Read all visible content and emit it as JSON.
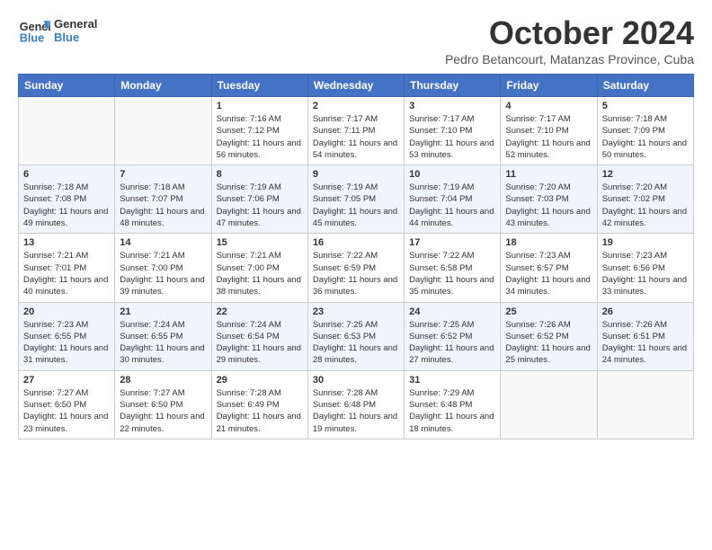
{
  "header": {
    "logo_line1": "General",
    "logo_line2": "Blue",
    "month": "October 2024",
    "location": "Pedro Betancourt, Matanzas Province, Cuba"
  },
  "days_of_week": [
    "Sunday",
    "Monday",
    "Tuesday",
    "Wednesday",
    "Thursday",
    "Friday",
    "Saturday"
  ],
  "weeks": [
    [
      {
        "day": "",
        "info": ""
      },
      {
        "day": "",
        "info": ""
      },
      {
        "day": "1",
        "info": "Sunrise: 7:16 AM\nSunset: 7:12 PM\nDaylight: 11 hours and 56 minutes."
      },
      {
        "day": "2",
        "info": "Sunrise: 7:17 AM\nSunset: 7:11 PM\nDaylight: 11 hours and 54 minutes."
      },
      {
        "day": "3",
        "info": "Sunrise: 7:17 AM\nSunset: 7:10 PM\nDaylight: 11 hours and 53 minutes."
      },
      {
        "day": "4",
        "info": "Sunrise: 7:17 AM\nSunset: 7:10 PM\nDaylight: 11 hours and 52 minutes."
      },
      {
        "day": "5",
        "info": "Sunrise: 7:18 AM\nSunset: 7:09 PM\nDaylight: 11 hours and 50 minutes."
      }
    ],
    [
      {
        "day": "6",
        "info": "Sunrise: 7:18 AM\nSunset: 7:08 PM\nDaylight: 11 hours and 49 minutes."
      },
      {
        "day": "7",
        "info": "Sunrise: 7:18 AM\nSunset: 7:07 PM\nDaylight: 11 hours and 48 minutes."
      },
      {
        "day": "8",
        "info": "Sunrise: 7:19 AM\nSunset: 7:06 PM\nDaylight: 11 hours and 47 minutes."
      },
      {
        "day": "9",
        "info": "Sunrise: 7:19 AM\nSunset: 7:05 PM\nDaylight: 11 hours and 45 minutes."
      },
      {
        "day": "10",
        "info": "Sunrise: 7:19 AM\nSunset: 7:04 PM\nDaylight: 11 hours and 44 minutes."
      },
      {
        "day": "11",
        "info": "Sunrise: 7:20 AM\nSunset: 7:03 PM\nDaylight: 11 hours and 43 minutes."
      },
      {
        "day": "12",
        "info": "Sunrise: 7:20 AM\nSunset: 7:02 PM\nDaylight: 11 hours and 42 minutes."
      }
    ],
    [
      {
        "day": "13",
        "info": "Sunrise: 7:21 AM\nSunset: 7:01 PM\nDaylight: 11 hours and 40 minutes."
      },
      {
        "day": "14",
        "info": "Sunrise: 7:21 AM\nSunset: 7:00 PM\nDaylight: 11 hours and 39 minutes."
      },
      {
        "day": "15",
        "info": "Sunrise: 7:21 AM\nSunset: 7:00 PM\nDaylight: 11 hours and 38 minutes."
      },
      {
        "day": "16",
        "info": "Sunrise: 7:22 AM\nSunset: 6:59 PM\nDaylight: 11 hours and 36 minutes."
      },
      {
        "day": "17",
        "info": "Sunrise: 7:22 AM\nSunset: 6:58 PM\nDaylight: 11 hours and 35 minutes."
      },
      {
        "day": "18",
        "info": "Sunrise: 7:23 AM\nSunset: 6:57 PM\nDaylight: 11 hours and 34 minutes."
      },
      {
        "day": "19",
        "info": "Sunrise: 7:23 AM\nSunset: 6:56 PM\nDaylight: 11 hours and 33 minutes."
      }
    ],
    [
      {
        "day": "20",
        "info": "Sunrise: 7:23 AM\nSunset: 6:55 PM\nDaylight: 11 hours and 31 minutes."
      },
      {
        "day": "21",
        "info": "Sunrise: 7:24 AM\nSunset: 6:55 PM\nDaylight: 11 hours and 30 minutes."
      },
      {
        "day": "22",
        "info": "Sunrise: 7:24 AM\nSunset: 6:54 PM\nDaylight: 11 hours and 29 minutes."
      },
      {
        "day": "23",
        "info": "Sunrise: 7:25 AM\nSunset: 6:53 PM\nDaylight: 11 hours and 28 minutes."
      },
      {
        "day": "24",
        "info": "Sunrise: 7:25 AM\nSunset: 6:52 PM\nDaylight: 11 hours and 27 minutes."
      },
      {
        "day": "25",
        "info": "Sunrise: 7:26 AM\nSunset: 6:52 PM\nDaylight: 11 hours and 25 minutes."
      },
      {
        "day": "26",
        "info": "Sunrise: 7:26 AM\nSunset: 6:51 PM\nDaylight: 11 hours and 24 minutes."
      }
    ],
    [
      {
        "day": "27",
        "info": "Sunrise: 7:27 AM\nSunset: 6:50 PM\nDaylight: 11 hours and 23 minutes."
      },
      {
        "day": "28",
        "info": "Sunrise: 7:27 AM\nSunset: 6:50 PM\nDaylight: 11 hours and 22 minutes."
      },
      {
        "day": "29",
        "info": "Sunrise: 7:28 AM\nSunset: 6:49 PM\nDaylight: 11 hours and 21 minutes."
      },
      {
        "day": "30",
        "info": "Sunrise: 7:28 AM\nSunset: 6:48 PM\nDaylight: 11 hours and 19 minutes."
      },
      {
        "day": "31",
        "info": "Sunrise: 7:29 AM\nSunset: 6:48 PM\nDaylight: 11 hours and 18 minutes."
      },
      {
        "day": "",
        "info": ""
      },
      {
        "day": "",
        "info": ""
      }
    ]
  ]
}
